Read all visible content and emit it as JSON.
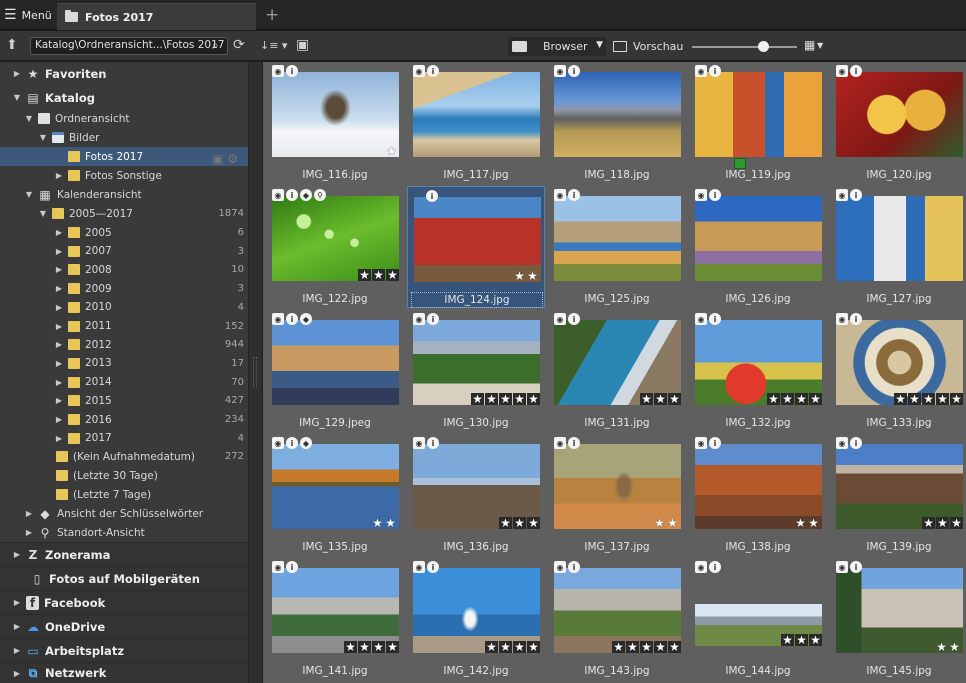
{
  "tabbar": {
    "menu_label": "Menü",
    "active_tab": "Fotos 2017",
    "add_tab": "+"
  },
  "toolbar": {
    "path": "Katalog\\Ordneransicht...\\Fotos 2017",
    "browser_label": "Browser",
    "preview_label": "Vorschau",
    "zoom_level": 0.68
  },
  "sidebar": {
    "favoriten": "Favoriten",
    "katalog": "Katalog",
    "ordneransicht": "Ordneransicht",
    "bilder": "Bilder",
    "fotos_2017": "Fotos 2017",
    "fotos_sonstige": "Fotos Sonstige",
    "kalenderansicht": "Kalenderansicht",
    "range": {
      "label": "2005—2017",
      "count": "1874"
    },
    "years": [
      {
        "label": "2005",
        "count": "6"
      },
      {
        "label": "2007",
        "count": "3"
      },
      {
        "label": "2008",
        "count": "10"
      },
      {
        "label": "2009",
        "count": "3"
      },
      {
        "label": "2010",
        "count": "4"
      },
      {
        "label": "2011",
        "count": "152"
      },
      {
        "label": "2012",
        "count": "944"
      },
      {
        "label": "2013",
        "count": "17"
      },
      {
        "label": "2014",
        "count": "70"
      },
      {
        "label": "2015",
        "count": "427"
      },
      {
        "label": "2016",
        "count": "234"
      },
      {
        "label": "2017",
        "count": "4"
      }
    ],
    "kein_datum": {
      "label": "(Kein Aufnahmedatum)",
      "count": "272"
    },
    "letzte_30": "(Letzte 30 Tage)",
    "letzte_7": "(Letzte 7 Tage)",
    "schluesselwoerter": "Ansicht der Schlüsselwörter",
    "standort": "Standort-Ansicht",
    "zonerama": "Zonerama",
    "mobil": "Fotos auf Mobilgeräten",
    "facebook": "Facebook",
    "onedrive": "OneDrive",
    "arbeitsplatz": "Arbeitsplatz",
    "netzwerk": "Netzwerk"
  },
  "photos": [
    {
      "name": "IMG_116.jpg",
      "stars": 1,
      "scene": "winter-tree"
    },
    {
      "name": "IMG_117.jpg",
      "stars": 0,
      "scene": "coast-boats"
    },
    {
      "name": "IMG_118.jpg",
      "stars": 0,
      "scene": "savanna-mountains"
    },
    {
      "name": "IMG_119.jpg",
      "stars": 0,
      "scene": "colorful-street",
      "color_tag": "#2f9a2f"
    },
    {
      "name": "IMG_120.jpg",
      "stars": 0,
      "scene": "tacos"
    },
    {
      "name": "IMG_122.jpg",
      "stars": 3,
      "scene": "leaf-drops"
    },
    {
      "name": "IMG_124.jpg",
      "stars": 2,
      "scene": "red-building",
      "selected": true
    },
    {
      "name": "IMG_125.jpg",
      "stars": 0,
      "scene": "mosaic-park"
    },
    {
      "name": "IMG_126.jpg",
      "stars": 0,
      "scene": "aqueduct"
    },
    {
      "name": "IMG_127.jpg",
      "stars": 0,
      "scene": "white-village"
    },
    {
      "name": "IMG_129.jpeg",
      "stars": 0,
      "scene": "plaza-bridge"
    },
    {
      "name": "IMG_130.jpg",
      "stars": 5,
      "scene": "forest-valley"
    },
    {
      "name": "IMG_131.jpg",
      "stars": 3,
      "scene": "rocky-bay"
    },
    {
      "name": "IMG_132.jpg",
      "stars": 4,
      "scene": "butterflies"
    },
    {
      "name": "IMG_133.jpg",
      "stars": 5,
      "scene": "dome"
    },
    {
      "name": "IMG_135.jpg",
      "stars": 2,
      "scene": "autumn-lake"
    },
    {
      "name": "IMG_136.jpg",
      "stars": 3,
      "scene": "pier"
    },
    {
      "name": "IMG_137.jpg",
      "stars": 2,
      "scene": "squirrel"
    },
    {
      "name": "IMG_138.jpg",
      "stars": 2,
      "scene": "canyon"
    },
    {
      "name": "IMG_139.jpg",
      "stars": 3,
      "scene": "canyon-trail"
    },
    {
      "name": "IMG_141.jpg",
      "stars": 4,
      "scene": "mountain-road"
    },
    {
      "name": "IMG_142.jpg",
      "stars": 4,
      "scene": "seagull"
    },
    {
      "name": "IMG_143.jpg",
      "stars": 5,
      "scene": "rock-valley"
    },
    {
      "name": "IMG_144.jpg",
      "stars": 3,
      "scene": "meadow-lake"
    },
    {
      "name": "IMG_145.jpg",
      "stars": 2,
      "scene": "el-capitan"
    }
  ]
}
